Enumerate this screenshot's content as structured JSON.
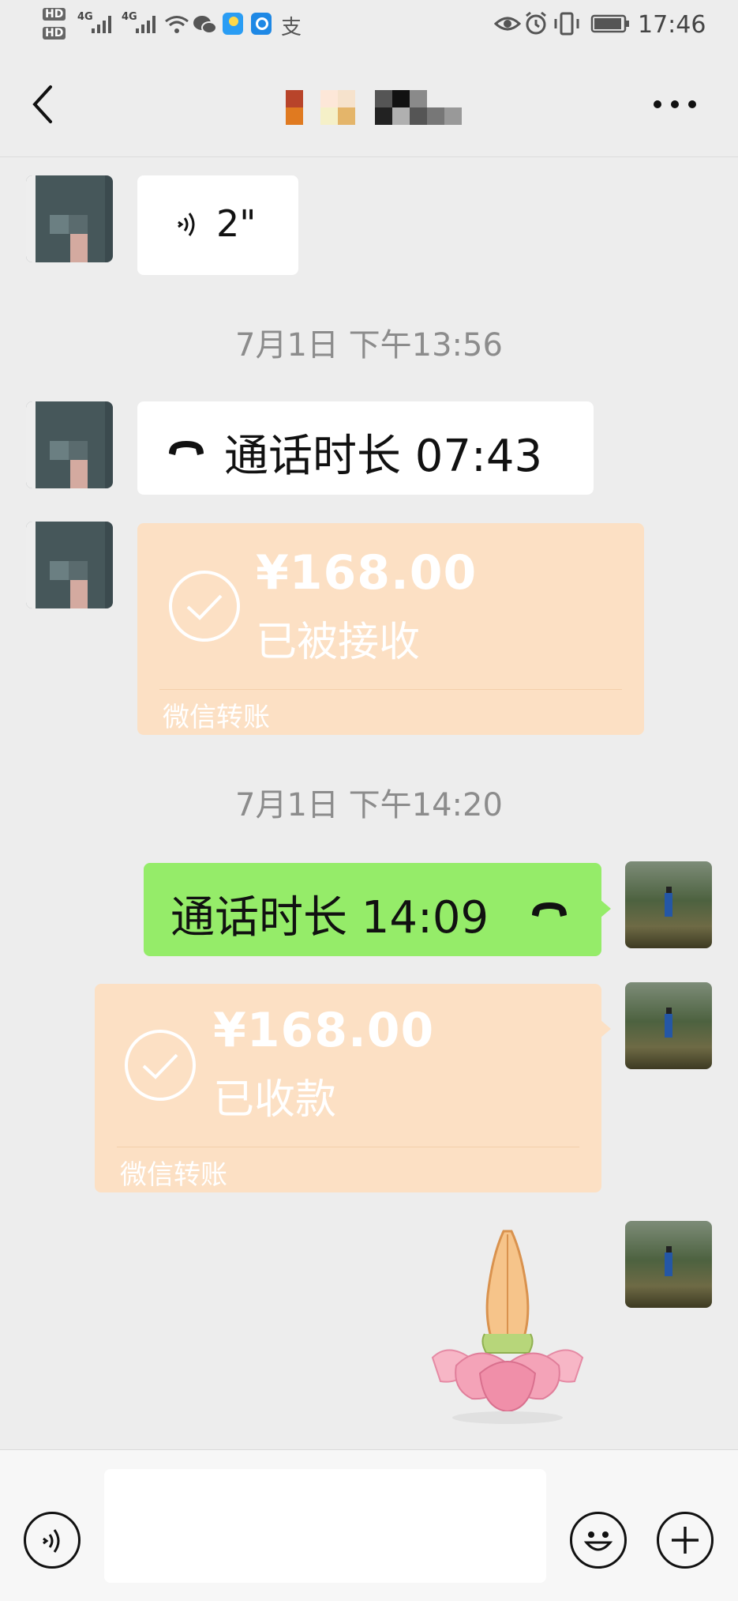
{
  "status_bar": {
    "hd1": "HD",
    "hd2": "HD",
    "net1": "4G",
    "net2": "4G",
    "alipay_glyph": "支",
    "time": "17:46"
  },
  "header": {
    "contact_name": ""
  },
  "messages": {
    "voice": {
      "duration": "2\""
    },
    "time1": "7月1日 下午13:56",
    "call_in": {
      "text": "通话时长 07:43"
    },
    "transfer_in": {
      "amount": "¥168.00",
      "status": "已被接收",
      "label": "微信转账"
    },
    "time2": "7月1日 下午14:20",
    "call_out": {
      "text": "通话时长 14:09"
    },
    "transfer_out": {
      "amount": "¥168.00",
      "status": "已收款",
      "label": "微信转账"
    }
  },
  "colors": {
    "background": "#ededed",
    "outgoing_bubble": "#95ec69",
    "transfer_card": "#fce0c4",
    "timestamp": "#8c8c8c"
  },
  "icons": [
    "back-arrow-icon",
    "more-icon",
    "voice-wave-icon",
    "phone-icon",
    "check-circle-icon",
    "voice-input-icon",
    "emoji-icon",
    "plus-icon",
    "praying-hands-lotus-sticker"
  ]
}
